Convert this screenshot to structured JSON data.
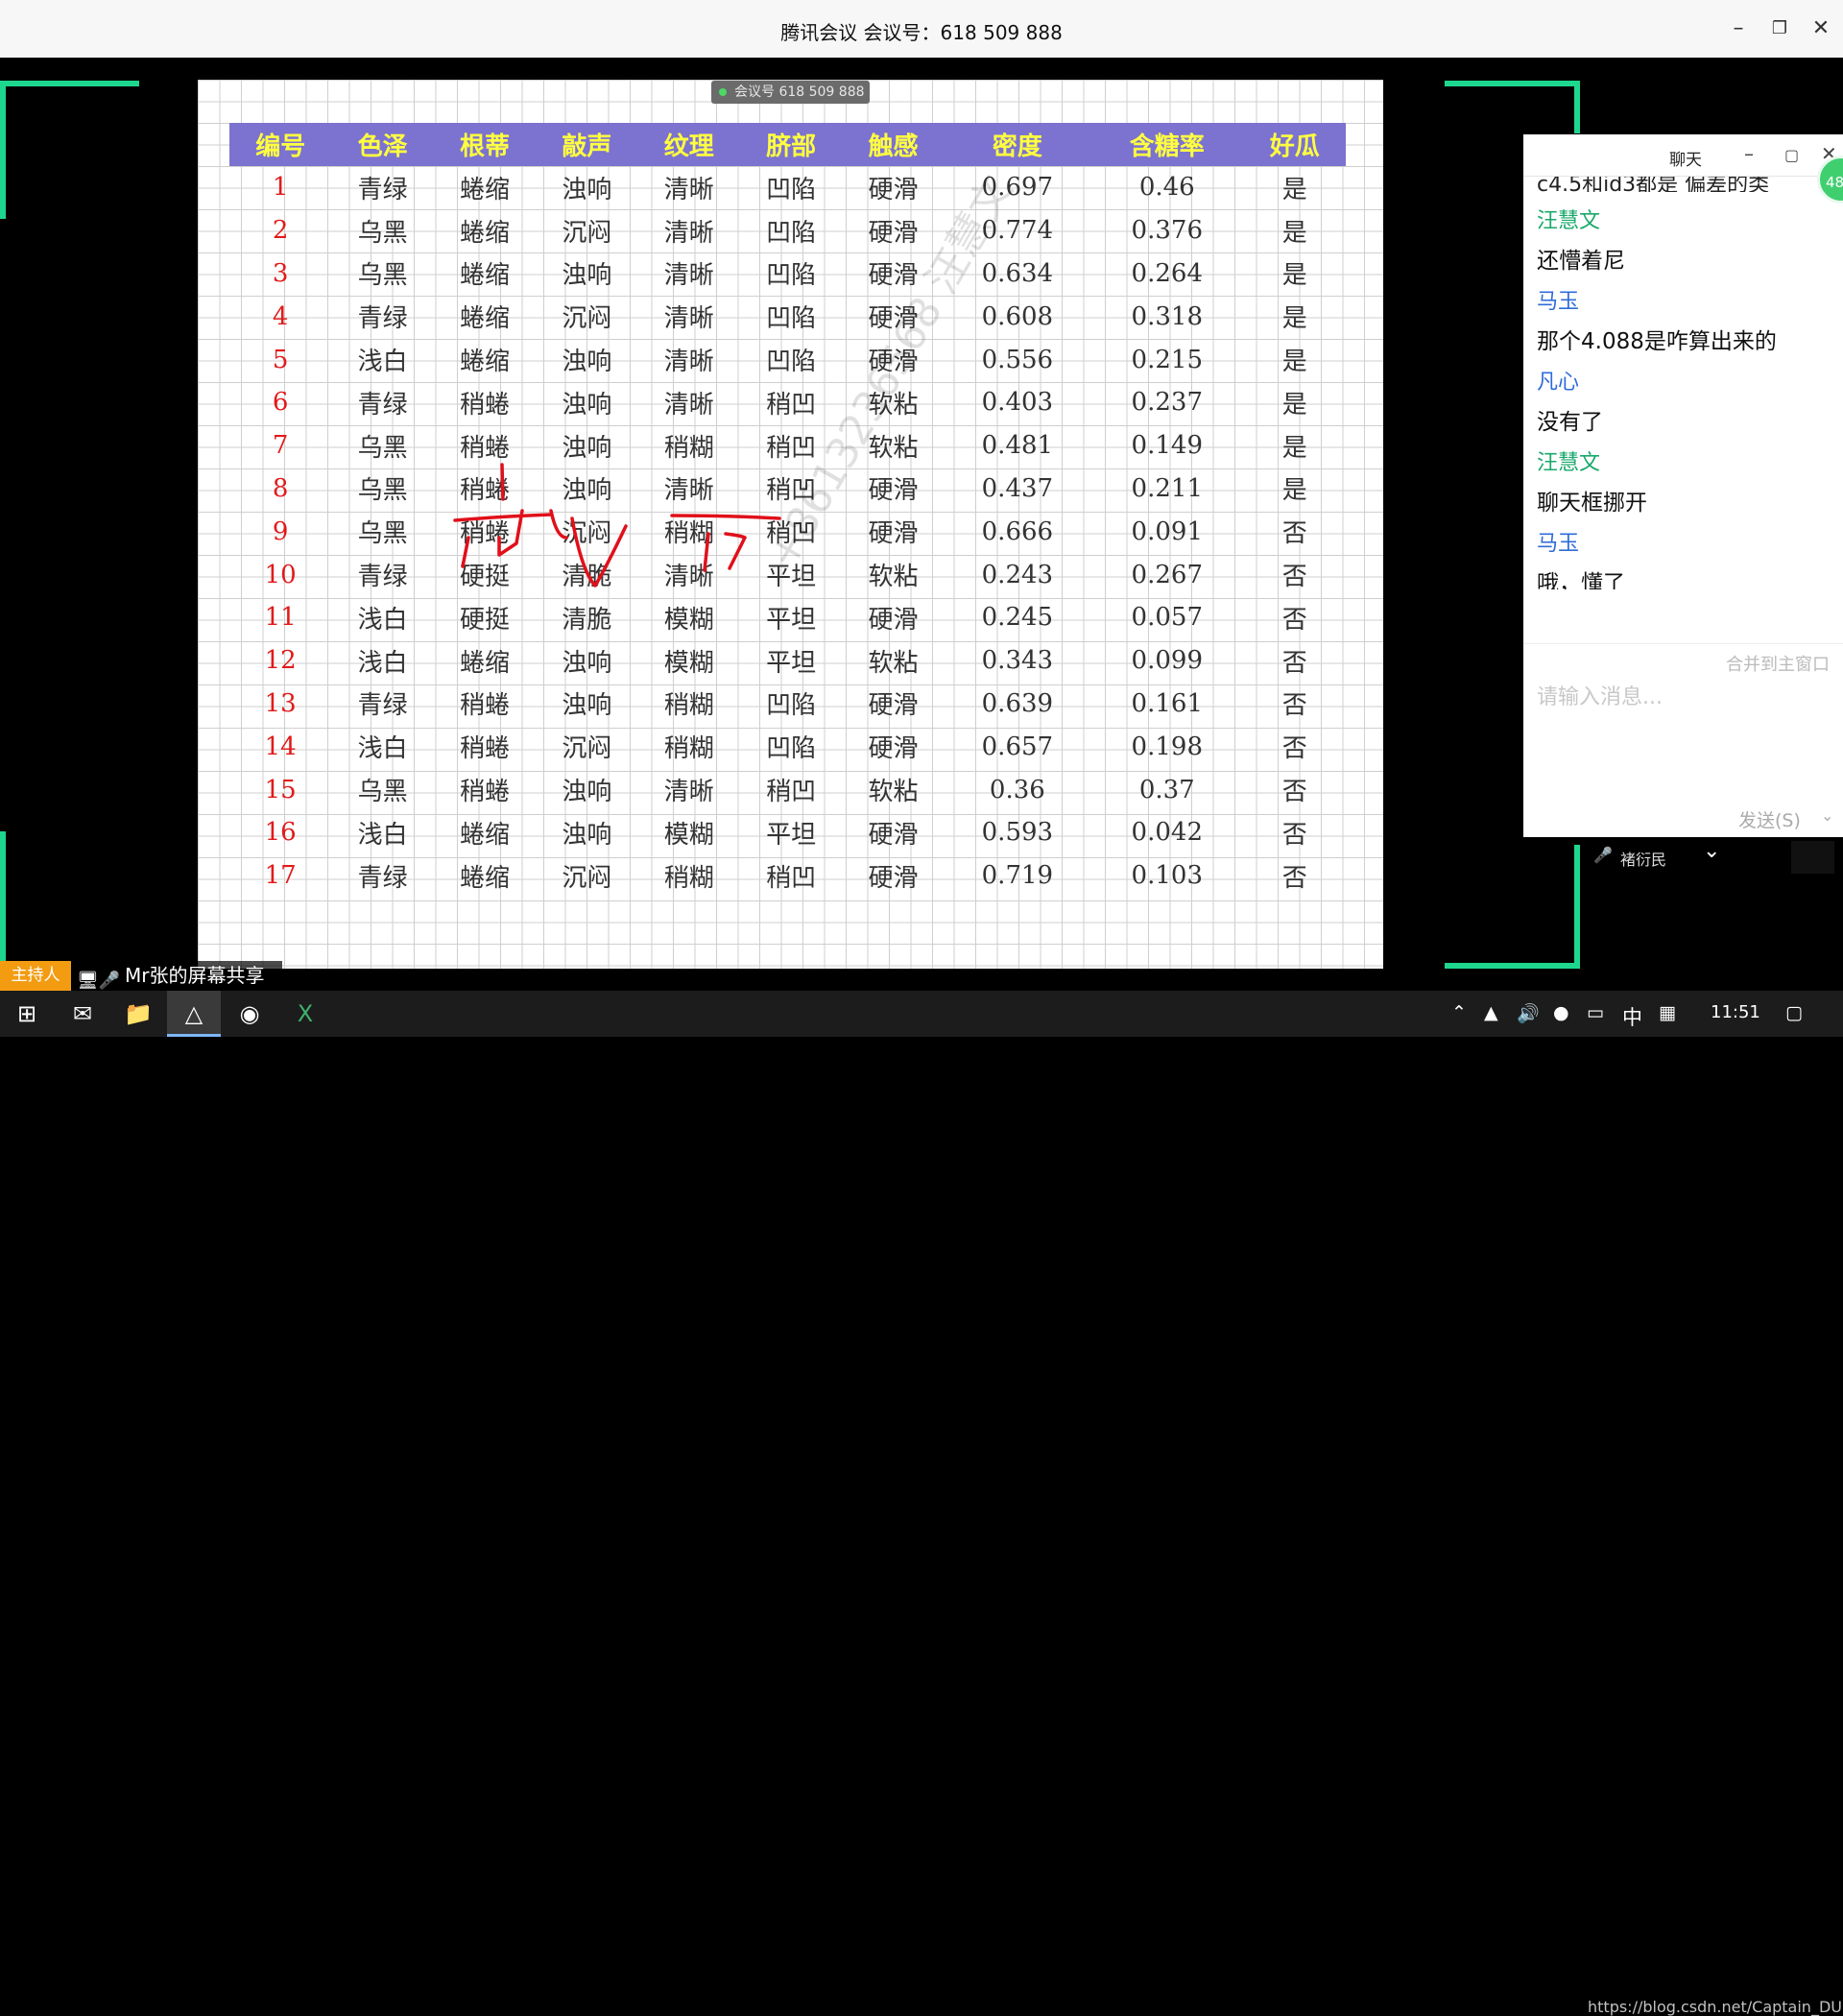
{
  "window": {
    "title": "腾讯会议 会议号：618 509 888",
    "minimize_icon": "minimize-icon",
    "restore_icon": "restore-icon",
    "close_icon": "close-icon"
  },
  "share": {
    "meeting_pill": "会议号 618 509 888",
    "watermark": "+8613236568 汪慧文",
    "host_badge": "主持人",
    "sharer_label": "Mr张的屏幕共享",
    "speaker_name": "褚衍民"
  },
  "table": {
    "headers": [
      "编号",
      "色泽",
      "根蒂",
      "敲声",
      "纹理",
      "脐部",
      "触感",
      "密度",
      "含糖率",
      "好瓜"
    ],
    "rows": [
      [
        "1",
        "青绿",
        "蜷缩",
        "浊响",
        "清晰",
        "凹陷",
        "硬滑",
        "0.697",
        "0.46",
        "是"
      ],
      [
        "2",
        "乌黑",
        "蜷缩",
        "沉闷",
        "清晰",
        "凹陷",
        "硬滑",
        "0.774",
        "0.376",
        "是"
      ],
      [
        "3",
        "乌黑",
        "蜷缩",
        "浊响",
        "清晰",
        "凹陷",
        "硬滑",
        "0.634",
        "0.264",
        "是"
      ],
      [
        "4",
        "青绿",
        "蜷缩",
        "沉闷",
        "清晰",
        "凹陷",
        "硬滑",
        "0.608",
        "0.318",
        "是"
      ],
      [
        "5",
        "浅白",
        "蜷缩",
        "浊响",
        "清晰",
        "凹陷",
        "硬滑",
        "0.556",
        "0.215",
        "是"
      ],
      [
        "6",
        "青绿",
        "稍蜷",
        "浊响",
        "清晰",
        "稍凹",
        "软粘",
        "0.403",
        "0.237",
        "是"
      ],
      [
        "7",
        "乌黑",
        "稍蜷",
        "浊响",
        "稍糊",
        "稍凹",
        "软粘",
        "0.481",
        "0.149",
        "是"
      ],
      [
        "8",
        "乌黑",
        "稍蜷",
        "浊响",
        "清晰",
        "稍凹",
        "硬滑",
        "0.437",
        "0.211",
        "是"
      ],
      [
        "9",
        "乌黑",
        "稍蜷",
        "沉闷",
        "稍糊",
        "稍凹",
        "硬滑",
        "0.666",
        "0.091",
        "否"
      ],
      [
        "10",
        "青绿",
        "硬挺",
        "清脆",
        "清晰",
        "平坦",
        "软粘",
        "0.243",
        "0.267",
        "否"
      ],
      [
        "11",
        "浅白",
        "硬挺",
        "清脆",
        "模糊",
        "平坦",
        "硬滑",
        "0.245",
        "0.057",
        "否"
      ],
      [
        "12",
        "浅白",
        "蜷缩",
        "浊响",
        "模糊",
        "平坦",
        "软粘",
        "0.343",
        "0.099",
        "否"
      ],
      [
        "13",
        "青绿",
        "稍蜷",
        "浊响",
        "稍糊",
        "凹陷",
        "硬滑",
        "0.639",
        "0.161",
        "否"
      ],
      [
        "14",
        "浅白",
        "稍蜷",
        "沉闷",
        "稍糊",
        "凹陷",
        "硬滑",
        "0.657",
        "0.198",
        "否"
      ],
      [
        "15",
        "乌黑",
        "稍蜷",
        "浊响",
        "清晰",
        "稍凹",
        "软粘",
        "0.36",
        "0.37",
        "否"
      ],
      [
        "16",
        "浅白",
        "蜷缩",
        "浊响",
        "模糊",
        "平坦",
        "硬滑",
        "0.593",
        "0.042",
        "否"
      ],
      [
        "17",
        "青绿",
        "蜷缩",
        "沉闷",
        "稍糊",
        "稍凹",
        "硬滑",
        "0.719",
        "0.103",
        "否"
      ]
    ]
  },
  "chat": {
    "title": "聊天",
    "partial_top": "c4.5和id3都是 偏差的类",
    "messages": [
      {
        "sender": "汪慧文",
        "text": "还懵着尼",
        "color": "green"
      },
      {
        "sender": "马玉",
        "text": "那个4.088是咋算出来的",
        "color": "blue"
      },
      {
        "sender": "凡心",
        "text": "没有了",
        "color": "blue"
      },
      {
        "sender": "汪慧文",
        "text": "聊天框挪开",
        "color": "green"
      },
      {
        "sender": "马玉",
        "text": "哦，懂了",
        "color": "blue"
      }
    ],
    "merge_label": "合并到主窗口",
    "input_placeholder": "请输入消息...",
    "send_label": "发送(S)",
    "unread_badge": "48"
  },
  "taskbar": {
    "ime": "中",
    "time": "11:51",
    "url": "https://blog.csdn.net/Captain_DUDU"
  },
  "colors": {
    "header_bg": "#7c72cf",
    "header_text": "#ffff40",
    "index_text": "#e21a1a",
    "frame_green": "#1ed78f",
    "ink_red": "#e0101a"
  }
}
